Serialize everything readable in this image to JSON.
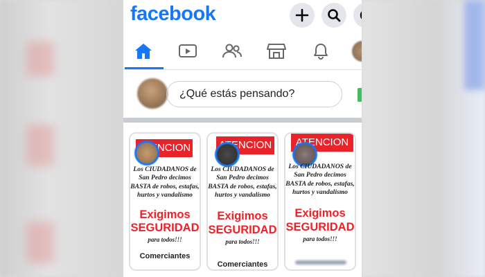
{
  "header": {
    "logo_text": "facebook",
    "brand_color": "#1877f2"
  },
  "actions": [
    {
      "name": "plus-icon"
    },
    {
      "name": "search-icon"
    },
    {
      "name": "messenger-icon"
    }
  ],
  "nav": {
    "active": "home",
    "tabs": [
      "home-icon",
      "watch-icon",
      "friends-icon",
      "marketplace-icon",
      "notifications-icon",
      "menu-profile-icon"
    ]
  },
  "composer": {
    "placeholder": "¿Qué estás pensando?"
  },
  "stories": [
    {
      "banner": "ATENCION",
      "text": "Los CIUDADANOS de San Pedro decimos BASTA de robos, estafas, hurtos y vandalismo",
      "demand_line1": "Exigimos",
      "demand_line2": "SEGURIDAD",
      "subtext": "para todos!!!",
      "footer": "Comerciantes"
    },
    {
      "banner": "ATENCION",
      "text": "Los CIUDADANOS de San Pedro decimos BASTA de robos, estafas, hurtos y vandalismo",
      "demand_line1": "Exigimos",
      "demand_line2": "SEGURIDAD",
      "subtext": "para todos!!!",
      "footer": "Comerciantes"
    },
    {
      "banner": "ATENCION",
      "text": "Los CIUDADANOS de San Pedro decimos BASTA de robos, estafas, hurtos y vandalismo",
      "demand_line1": "Exigimos",
      "demand_line2": "SEGURIDAD",
      "subtext": "para todos!!!",
      "footer": ""
    }
  ],
  "colors": {
    "alert_red": "#e8232a",
    "divider": "#c9ccd1"
  }
}
